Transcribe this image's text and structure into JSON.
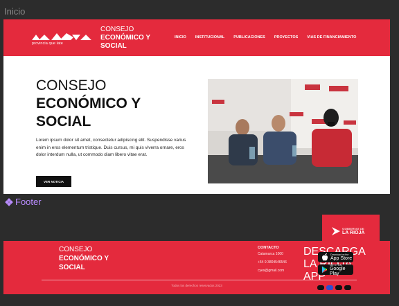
{
  "frames": {
    "inicio": "Inicio",
    "footer": "Footer"
  },
  "header": {
    "logo_subtitle": "provincia que late",
    "brand": [
      "CONSEJO",
      "ECONÓMICO Y",
      "SOCIAL"
    ],
    "nav": [
      "INICIO",
      "INSTITUCIONAL",
      "PUBLICACIONES",
      "PROYECTOS",
      "VIAS DE FINANCIAMIENTO"
    ]
  },
  "hero": {
    "title": [
      "CONSEJO",
      "ECONÓMICO Y",
      "SOCIAL"
    ],
    "body": "Lorem ipsum dolor sit amet, consectetur adipiscing elit. Suspendisse varius enim in eros elementum tristique. Duis cursus, mi quis viverra ornare, eros dolor interdum nulla, ut commodo diam libero vitae erat.",
    "button": "VER NOTICIA"
  },
  "gov_tab": {
    "line1": "GOBIERNO DE",
    "line2": "LA RIOJA"
  },
  "footer": {
    "brand": [
      "CONSEJO",
      "ECONÓMICO Y",
      "SOCIAL"
    ],
    "contact_heading": "CONTACTO",
    "address": "Catamarca 1000",
    "phone": "+54 9 3804546546",
    "email": "cyes@gmail.com",
    "download_heading": "DESCARGA LA RIOJA APP",
    "app_store": {
      "small": "Download on the",
      "large": "App Store"
    },
    "google_play": {
      "small": "GET IT ON",
      "large": "Google Play"
    },
    "copyright": "Todos los derechos reservados 2023",
    "socials": [
      "twitter-icon",
      "facebook-icon",
      "instagram-icon",
      "youtube-icon"
    ]
  },
  "colors": {
    "brand_red": "#e42a3d",
    "dark": "#111111",
    "frame_bg": "#2c2c2c",
    "frame_label_footer": "#b98cff"
  }
}
